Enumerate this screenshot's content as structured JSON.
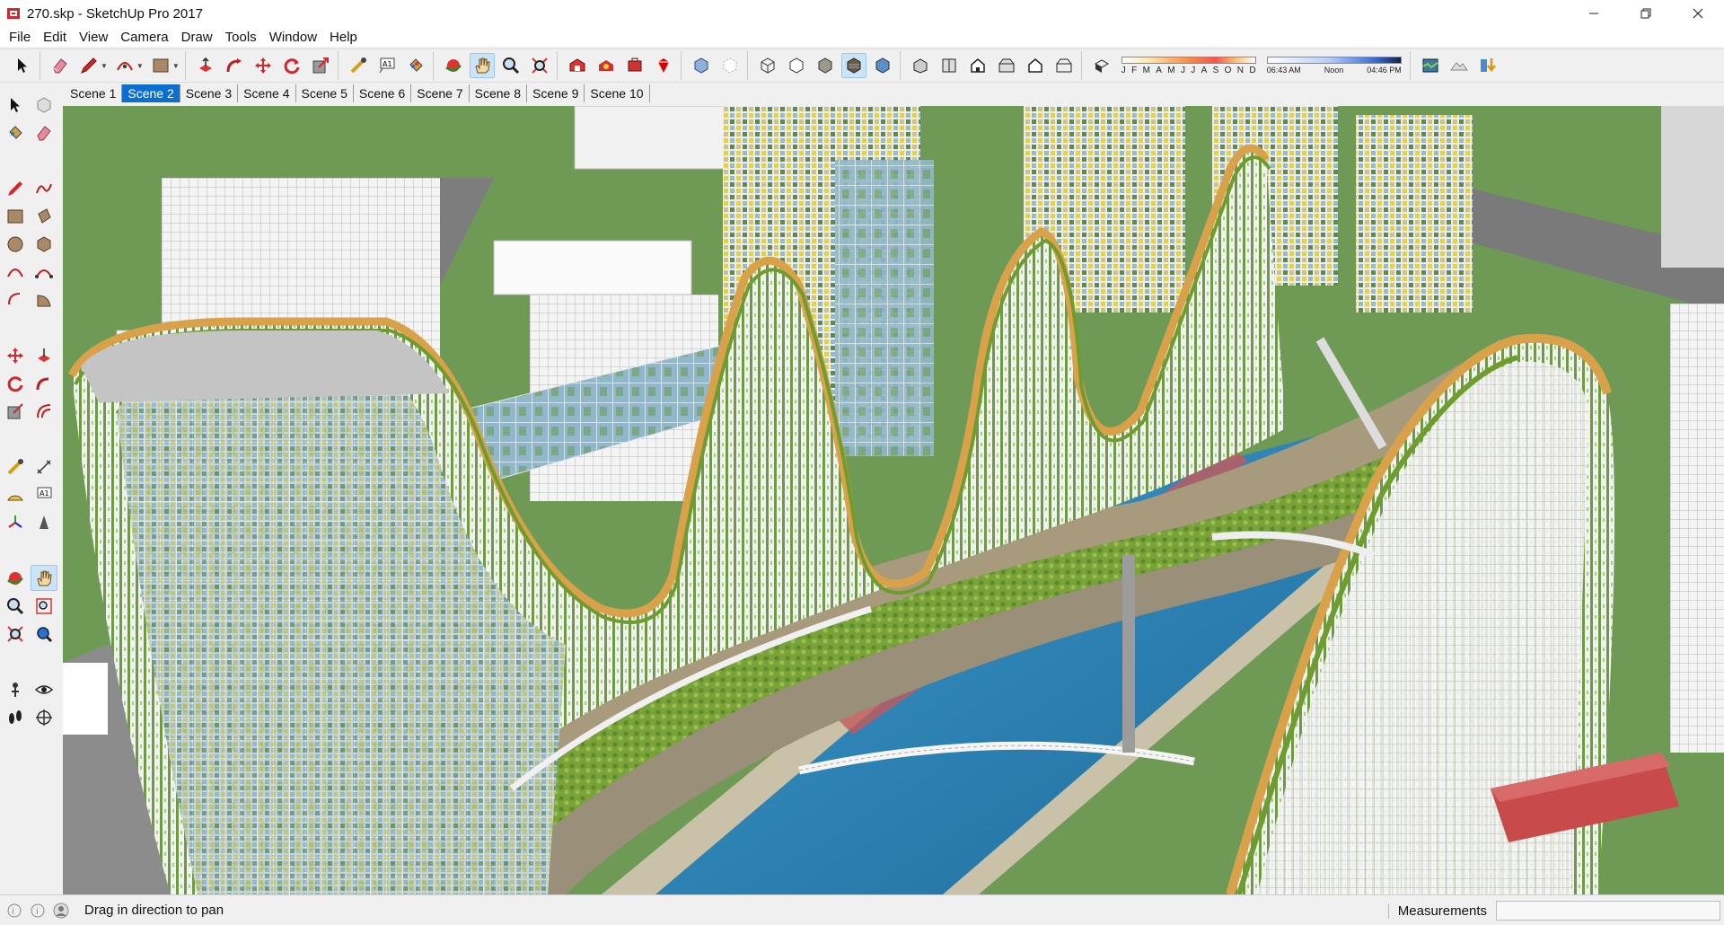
{
  "window": {
    "title": "270.skp - SketchUp Pro 2017",
    "controls": [
      "minimize",
      "restore",
      "close"
    ]
  },
  "menu": [
    "File",
    "Edit",
    "View",
    "Camera",
    "Draw",
    "Tools",
    "Window",
    "Help"
  ],
  "toolbar": {
    "shadow_months": [
      "J",
      "F",
      "M",
      "A",
      "M",
      "J",
      "J",
      "A",
      "S",
      "O",
      "N",
      "D"
    ],
    "time_start": "06:43 AM",
    "time_mid": "Noon",
    "time_end": "04:46 PM"
  },
  "scenes": {
    "tabs": [
      "Scene 1",
      "Scene 2",
      "Scene 3",
      "Scene 4",
      "Scene 5",
      "Scene 6",
      "Scene 7",
      "Scene 8",
      "Scene 9",
      "Scene 10"
    ],
    "active": "Scene 2"
  },
  "active_tool": "pan-tool",
  "status": {
    "message": "Drag in direction to pan",
    "measurements_label": "Measurements",
    "measurements_value": ""
  },
  "colors": {
    "accent": "#0a6fd1",
    "ground": "#6f9a55",
    "roof_wood": "#d9a24a",
    "greenery": "#6f9c2f",
    "water": "#2f7fb2",
    "glass": "#8fb8cc"
  }
}
